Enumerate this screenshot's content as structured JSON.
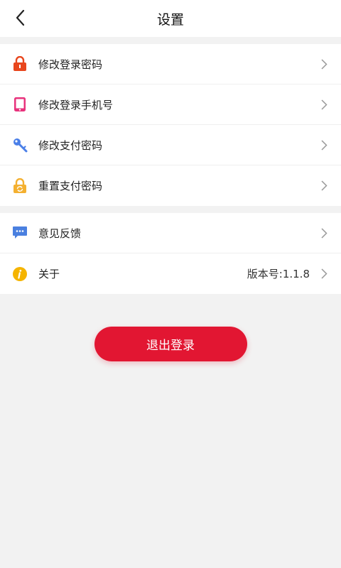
{
  "header": {
    "title": "设置"
  },
  "groups": [
    {
      "items": [
        {
          "label": "修改登录密码",
          "icon": "lock-icon",
          "color": "#e8461d"
        },
        {
          "label": "修改登录手机号",
          "icon": "phone-icon",
          "color": "#e8327c"
        },
        {
          "label": "修改支付密码",
          "icon": "key-icon",
          "color": "#4a7fe8"
        },
        {
          "label": "重置支付密码",
          "icon": "reset-lock-icon",
          "color": "#f4b030"
        }
      ]
    },
    {
      "items": [
        {
          "label": "意见反馈",
          "icon": "chat-icon",
          "color": "#4a80e0"
        },
        {
          "label": "关于",
          "icon": "info-icon",
          "color": "#f5b400",
          "value": "版本号:1.1.8"
        }
      ]
    }
  ],
  "logout": {
    "label": "退出登录",
    "color": "#e21632"
  }
}
